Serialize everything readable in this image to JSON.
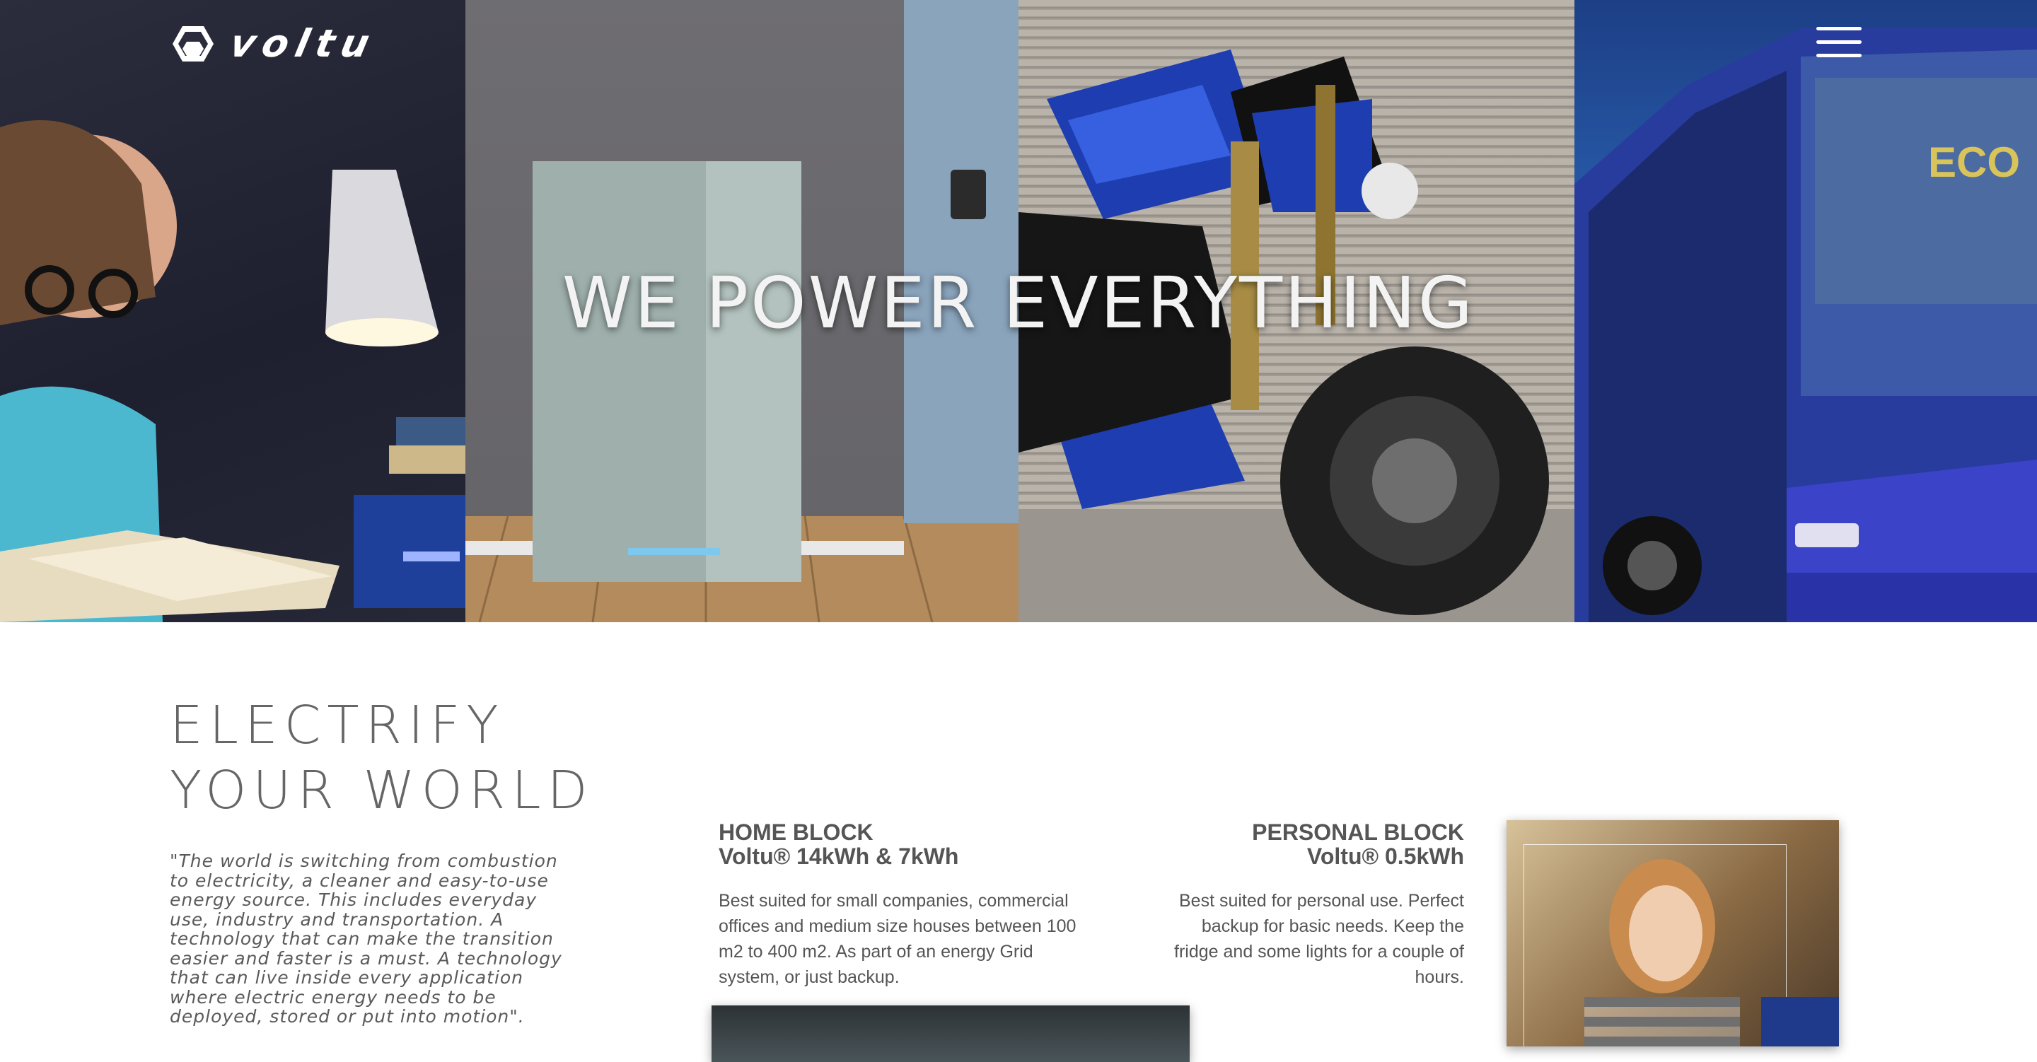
{
  "brand": {
    "wordmark": "voltu"
  },
  "hero": {
    "title": "WE POWER EVERYTHING",
    "panels": [
      "reading-lamp-scene",
      "home-battery-scene",
      "electric-motorcycle-scene",
      "electric-bus-scene"
    ]
  },
  "nav": {
    "menu_icon": "hamburger-menu-icon"
  },
  "intro": {
    "heading_line1": "ELECTRIFY",
    "heading_line2": "YOUR WORLD",
    "quote": "\"The world is switching from combustion to electricity, a cleaner and easy-to-use energy source. This includes everyday use, industry and transportation. A technology that can make the transition easier and faster is a must. A technology that can live inside every application where electric energy needs to be deployed, stored or put into motion\"."
  },
  "products": {
    "home": {
      "title": "HOME BLOCK",
      "subtitle": "Voltu® 14kWh & 7kWh",
      "description": "Best suited for small companies, commercial offices and medium size houses between 100 m2 to 400 m2. As part of an energy Grid system, or just backup."
    },
    "personal": {
      "title": "PERSONAL BLOCK",
      "subtitle": "Voltu® 0.5kWh",
      "description": "Best suited for personal use. Perfect backup for basic needs. Keep the fridge and some lights for a couple of hours."
    }
  },
  "colors": {
    "text": "#555555",
    "heading": "#666666",
    "hero_text": "#f3f3f3",
    "accent_blue": "#2436a8"
  }
}
